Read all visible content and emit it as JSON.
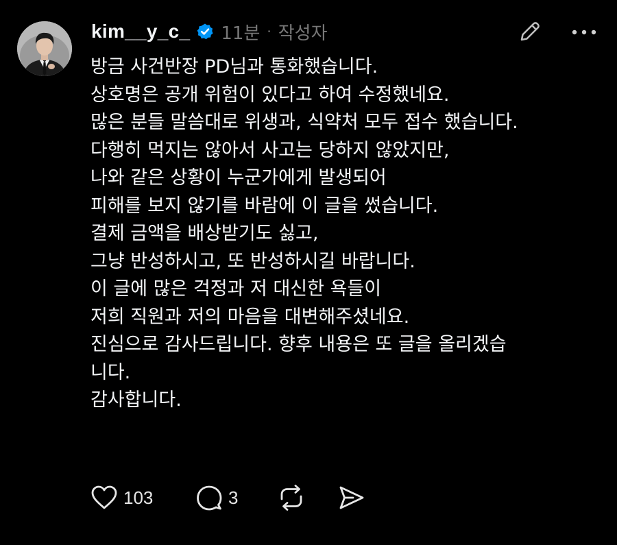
{
  "post": {
    "username": "kim__y_c_",
    "time": "11분",
    "separator": "·",
    "author_tag": "작성자",
    "lines": [
      "방금 사건반장 PD님과 통화했습니다.",
      "상호명은 공개 위험이 있다고 하여 수정했네요.",
      "많은 분들 말씀대로 위생과, 식약처 모두 접수 했습니다.",
      "다행히 먹지는 않아서 사고는 당하지 않았지만,",
      "나와 같은 상황이 누군가에게 발생되어",
      "피해를 보지 않기를 바람에 이 글을 썼습니다.",
      "결제 금액을 배상받기도 싫고,",
      "그냥 반성하시고, 또 반성하시길 바랍니다.",
      "이 글에 많은 걱정과 저 대신한 욕들이",
      "저희 직원과 저의 마음을 대변해주셨네요.",
      "진심으로 감사드립니다. 향후 내용은 또 글을 올리겠습",
      "니다.",
      "감사합니다."
    ],
    "like_count": "103",
    "reply_count": "3"
  },
  "icons": {
    "verified": "verified-badge-icon",
    "edit": "pencil-icon",
    "more": "more-horizontal-icon",
    "like": "heart-icon",
    "reply": "comment-icon",
    "repost": "repost-icon",
    "share": "send-icon"
  },
  "colors": {
    "background": "#000000",
    "text": "#f3f5f7",
    "muted": "#777777",
    "verified": "#0095f6"
  }
}
